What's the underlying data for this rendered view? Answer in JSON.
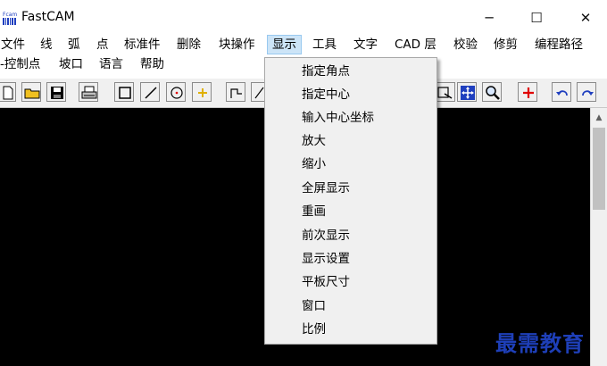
{
  "window": {
    "title": "FastCAM",
    "controls": {
      "minimize": "─",
      "maximize": "☐",
      "close": "✕"
    }
  },
  "menubar": {
    "row1": [
      "文件",
      "线",
      "弧",
      "点",
      "标准件",
      "删除",
      "块操作",
      "显示",
      "工具",
      "文字",
      "CAD 层",
      "校验",
      "修剪",
      "编程路径"
    ],
    "row2": [
      "-控制点",
      "坡口",
      "语言",
      "帮助"
    ],
    "active": "显示"
  },
  "dropdown": {
    "items": [
      "指定角点",
      "指定中心",
      "输入中心坐标",
      "放大",
      "缩小",
      "全屏显示",
      "重画",
      "前次显示",
      "显示设置",
      "平板尺寸",
      "窗口",
      "比例"
    ]
  },
  "toolbar": {
    "icons": [
      "new-file-icon",
      "open-folder-icon",
      "save-icon",
      "print-icon",
      "rectangle-icon",
      "line-icon",
      "circle-icon",
      "point-icon",
      "step-line-icon",
      "slant-line-icon",
      "zoom-window-icon",
      "zoom-all-icon",
      "zoom-magnify-icon",
      "add-cross-icon",
      "undo-icon",
      "redo-icon"
    ],
    "colors": {
      "accent_red": "#e00000",
      "accent_blue": "#1f3fbf",
      "folder_yellow": "#f0c020"
    }
  },
  "watermark": {
    "text": "最需教育",
    "color": "#1e3fb8"
  }
}
